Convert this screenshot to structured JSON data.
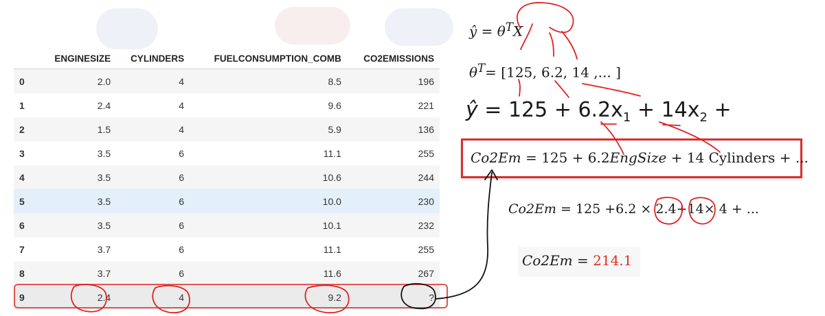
{
  "table": {
    "columns": [
      "",
      "ENGINESIZE",
      "CYLINDERS",
      "FUELCONSUMPTION_COMB",
      "CO2EMISSIONS"
    ],
    "rows": [
      [
        "0",
        "2.0",
        "4",
        "8.5",
        "196"
      ],
      [
        "1",
        "2.4",
        "4",
        "9.6",
        "221"
      ],
      [
        "2",
        "1.5",
        "4",
        "5.9",
        "136"
      ],
      [
        "3",
        "3.5",
        "6",
        "11.1",
        "255"
      ],
      [
        "4",
        "3.5",
        "6",
        "10.6",
        "244"
      ],
      [
        "5",
        "3.5",
        "6",
        "10.0",
        "230"
      ],
      [
        "6",
        "3.5",
        "6",
        "10.1",
        "232"
      ],
      [
        "7",
        "3.7",
        "6",
        "11.1",
        "255"
      ],
      [
        "8",
        "3.7",
        "6",
        "11.6",
        "267"
      ]
    ],
    "target_row": {
      "index": "9",
      "enginesize": "2.4",
      "cylinders": "4",
      "fuel": "9.2",
      "co2": "?"
    }
  },
  "equations": {
    "eq1": {
      "lhs": "ŷ",
      "eq": " = ",
      "theta": "θ",
      "sup": "T",
      "x": "X"
    },
    "eq2": {
      "theta": "θ",
      "sup": "T",
      "rest": "= [125, 6.2, 14 ,... ]"
    },
    "eq3": {
      "lhs": "ŷ",
      "part1": " = 125 + 6.2x",
      "sub1": "1",
      "part2": " + 14x",
      "sub2": "2",
      "part3": " +"
    },
    "eq4": {
      "lhs": "Co2Em",
      "part1": " = 125 + 6.2",
      "var": "EngSize",
      "part2": " + 14 Cylinders + ..."
    },
    "eq5": {
      "lhs": "Co2Em",
      "part1": " = 125 +6.2 × ",
      "v1": "2.4",
      "plus": "+",
      "v2": "14",
      "part2": "× 4 + ..."
    },
    "eq6": {
      "lhs": "Co2Em",
      "eq": " = ",
      "result": "214.1"
    }
  },
  "colors": {
    "annotation_red": "#e02020",
    "result_red": "#e0301e",
    "highlight_row": "#e3eff9"
  }
}
